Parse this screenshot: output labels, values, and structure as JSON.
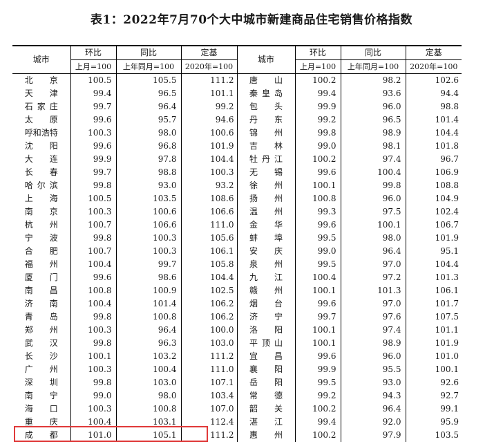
{
  "title": "表1：2022年7月70个大中城市新建商品住宅销售价格指数",
  "headers": {
    "city": "城市",
    "mom": "环比",
    "yoy": "同比",
    "base": "定基",
    "mom_sub": "上月=100",
    "yoy_sub": "上年同月=100",
    "base_sub": "2020年=100"
  },
  "rows": [
    {
      "city1": "北京",
      "mom1": "100.5",
      "yoy1": "105.5",
      "base1": "111.2",
      "city2": "唐山",
      "mom2": "100.2",
      "yoy2": "98.2",
      "base2": "102.6"
    },
    {
      "city1": "天津",
      "mom1": "99.4",
      "yoy1": "96.5",
      "base1": "101.1",
      "city2": "秦皇岛",
      "mom2": "99.4",
      "yoy2": "93.6",
      "base2": "94.4"
    },
    {
      "city1": "石家庄",
      "mom1": "99.7",
      "yoy1": "96.4",
      "base1": "99.2",
      "city2": "包头",
      "mom2": "99.9",
      "yoy2": "96.0",
      "base2": "98.8"
    },
    {
      "city1": "太原",
      "mom1": "99.6",
      "yoy1": "95.7",
      "base1": "94.6",
      "city2": "丹东",
      "mom2": "99.2",
      "yoy2": "96.5",
      "base2": "101.4"
    },
    {
      "city1": "呼和浩特",
      "mom1": "100.3",
      "yoy1": "98.0",
      "base1": "100.6",
      "city2": "锦州",
      "mom2": "99.8",
      "yoy2": "98.9",
      "base2": "104.4"
    },
    {
      "city1": "沈阳",
      "mom1": "99.6",
      "yoy1": "96.8",
      "base1": "101.9",
      "city2": "吉林",
      "mom2": "99.0",
      "yoy2": "98.1",
      "base2": "101.8"
    },
    {
      "city1": "大连",
      "mom1": "99.9",
      "yoy1": "97.8",
      "base1": "104.4",
      "city2": "牡丹江",
      "mom2": "100.2",
      "yoy2": "97.4",
      "base2": "96.7"
    },
    {
      "city1": "长春",
      "mom1": "99.7",
      "yoy1": "98.8",
      "base1": "100.3",
      "city2": "无锡",
      "mom2": "99.6",
      "yoy2": "100.4",
      "base2": "106.9"
    },
    {
      "city1": "哈尔滨",
      "mom1": "99.8",
      "yoy1": "93.0",
      "base1": "93.2",
      "city2": "徐州",
      "mom2": "100.1",
      "yoy2": "99.8",
      "base2": "108.8"
    },
    {
      "city1": "上海",
      "mom1": "100.5",
      "yoy1": "103.5",
      "base1": "108.6",
      "city2": "扬州",
      "mom2": "100.8",
      "yoy2": "96.0",
      "base2": "104.9"
    },
    {
      "city1": "南京",
      "mom1": "100.3",
      "yoy1": "100.6",
      "base1": "106.6",
      "city2": "温州",
      "mom2": "99.3",
      "yoy2": "97.5",
      "base2": "102.4"
    },
    {
      "city1": "杭州",
      "mom1": "100.7",
      "yoy1": "106.6",
      "base1": "111.0",
      "city2": "金华",
      "mom2": "99.6",
      "yoy2": "100.1",
      "base2": "106.7"
    },
    {
      "city1": "宁波",
      "mom1": "99.8",
      "yoy1": "100.3",
      "base1": "105.6",
      "city2": "蚌埠",
      "mom2": "99.5",
      "yoy2": "98.0",
      "base2": "101.9"
    },
    {
      "city1": "合肥",
      "mom1": "100.7",
      "yoy1": "100.3",
      "base1": "106.1",
      "city2": "安庆",
      "mom2": "99.0",
      "yoy2": "96.4",
      "base2": "95.1"
    },
    {
      "city1": "福州",
      "mom1": "100.4",
      "yoy1": "99.7",
      "base1": "105.8",
      "city2": "泉州",
      "mom2": "99.5",
      "yoy2": "97.0",
      "base2": "104.4"
    },
    {
      "city1": "厦门",
      "mom1": "99.6",
      "yoy1": "98.6",
      "base1": "104.4",
      "city2": "九江",
      "mom2": "100.4",
      "yoy2": "97.2",
      "base2": "101.3"
    },
    {
      "city1": "南昌",
      "mom1": "100.8",
      "yoy1": "100.9",
      "base1": "102.5",
      "city2": "赣州",
      "mom2": "100.1",
      "yoy2": "101.3",
      "base2": "106.1"
    },
    {
      "city1": "济南",
      "mom1": "100.4",
      "yoy1": "101.4",
      "base1": "106.2",
      "city2": "烟台",
      "mom2": "99.6",
      "yoy2": "97.0",
      "base2": "101.7"
    },
    {
      "city1": "青岛",
      "mom1": "99.8",
      "yoy1": "100.8",
      "base1": "106.2",
      "city2": "济宁",
      "mom2": "99.7",
      "yoy2": "97.6",
      "base2": "107.5"
    },
    {
      "city1": "郑州",
      "mom1": "100.3",
      "yoy1": "96.4",
      "base1": "100.0",
      "city2": "洛阳",
      "mom2": "100.1",
      "yoy2": "97.4",
      "base2": "101.1"
    },
    {
      "city1": "武汉",
      "mom1": "99.8",
      "yoy1": "96.3",
      "base1": "103.0",
      "city2": "平顶山",
      "mom2": "100.1",
      "yoy2": "98.9",
      "base2": "101.9"
    },
    {
      "city1": "长沙",
      "mom1": "100.1",
      "yoy1": "103.2",
      "base1": "111.2",
      "city2": "宜昌",
      "mom2": "99.6",
      "yoy2": "96.0",
      "base2": "101.0"
    },
    {
      "city1": "广州",
      "mom1": "100.3",
      "yoy1": "100.4",
      "base1": "111.0",
      "city2": "襄阳",
      "mom2": "99.9",
      "yoy2": "95.5",
      "base2": "100.1"
    },
    {
      "city1": "深圳",
      "mom1": "99.8",
      "yoy1": "103.0",
      "base1": "107.1",
      "city2": "岳阳",
      "mom2": "99.5",
      "yoy2": "93.0",
      "base2": "92.6"
    },
    {
      "city1": "南宁",
      "mom1": "99.0",
      "yoy1": "98.0",
      "base1": "103.4",
      "city2": "常德",
      "mom2": "99.2",
      "yoy2": "94.3",
      "base2": "92.7"
    },
    {
      "city1": "海口",
      "mom1": "100.3",
      "yoy1": "100.8",
      "base1": "107.0",
      "city2": "韶关",
      "mom2": "100.2",
      "yoy2": "96.4",
      "base2": "99.1"
    },
    {
      "city1": "重庆",
      "mom1": "100.4",
      "yoy1": "103.1",
      "base1": "112.4",
      "city2": "湛江",
      "mom2": "99.4",
      "yoy2": "92.0",
      "base2": "95.9"
    },
    {
      "city1": "成都",
      "mom1": "101.0",
      "yoy1": "105.1",
      "base1": "111.2",
      "city2": "惠州",
      "mom2": "100.2",
      "yoy2": "97.9",
      "base2": "103.5"
    }
  ],
  "colors": {
    "highlight": "#e03a3a",
    "rule": "#000000"
  }
}
